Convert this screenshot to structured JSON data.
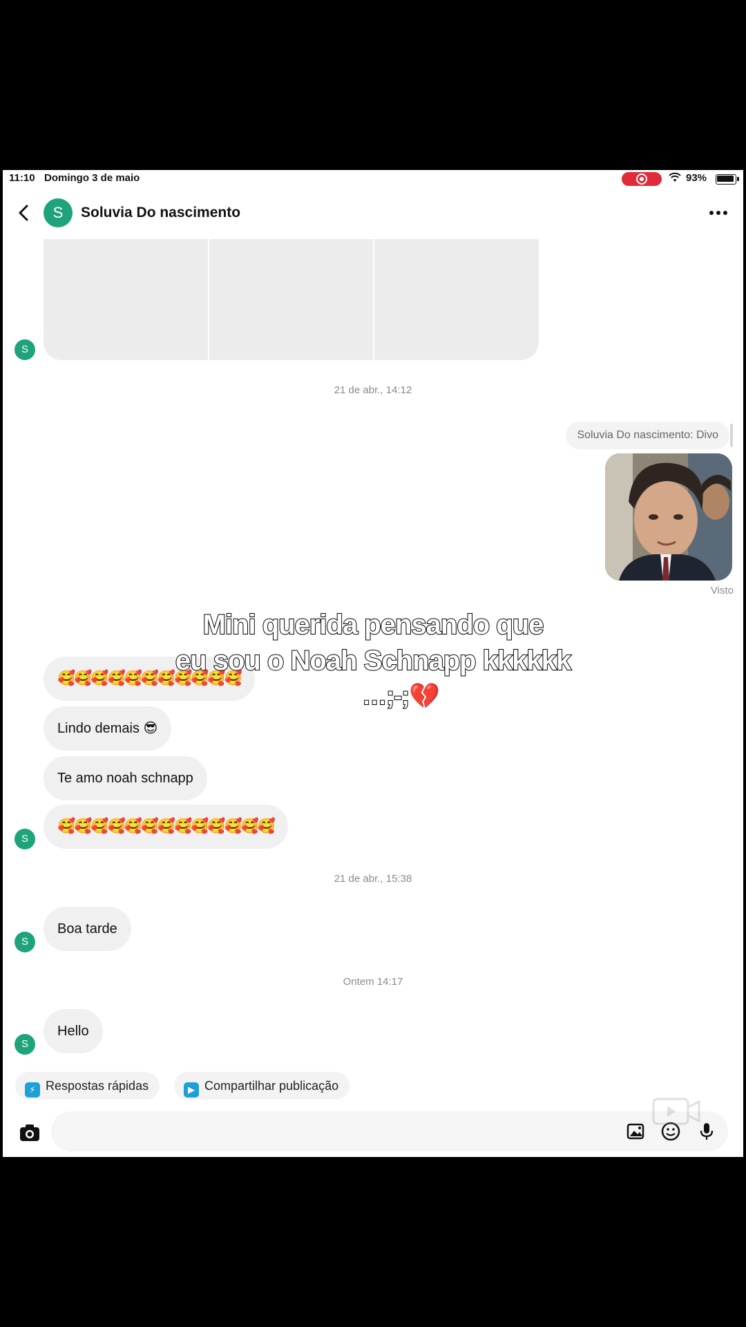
{
  "status_bar": {
    "time": "11:10",
    "date": "Domingo 3 de maio",
    "battery": "93%"
  },
  "header": {
    "contact_name": "Soluvia Do nascimento",
    "avatar_letter": "S"
  },
  "timestamps": {
    "t1": "21 de abr., 14:12",
    "t2": "21 de abr., 15:38",
    "t3": "Ontem 14:17"
  },
  "sent": {
    "reply_to": "Soluvia Do nascimento: Divo",
    "seen": "Visto"
  },
  "messages": {
    "emoji_row_1": "🥰🥰🥰🥰🥰🥰🥰🥰🥰🥰🥰",
    "lindo": "Lindo demais 😎",
    "te_amo": "Te amo noah schnapp",
    "emoji_row_2": "🥰🥰🥰🥰🥰🥰🥰🥰🥰🥰🥰🥰🥰",
    "boa_tarde": "Boa tarde",
    "hello": "Hello"
  },
  "overlay_caption": {
    "line1": "Mini querida pensando que",
    "line2": "eu sou o Noah Schnapp kkkkkk",
    "line3": "…;-;💔"
  },
  "quick_actions": {
    "quick_replies": "Respostas rápidas",
    "share_post": "Compartilhar publicação"
  },
  "icons": {
    "back": "chevron-left-icon",
    "more": "more-horizontal-icon",
    "camera": "camera-icon",
    "gallery": "gallery-icon",
    "sticker": "sticker-icon",
    "mic": "microphone-icon"
  },
  "colors": {
    "avatar_green": "#1fa37a",
    "record_red": "#e12b3a",
    "chip_blue": "#1ea0d6"
  }
}
